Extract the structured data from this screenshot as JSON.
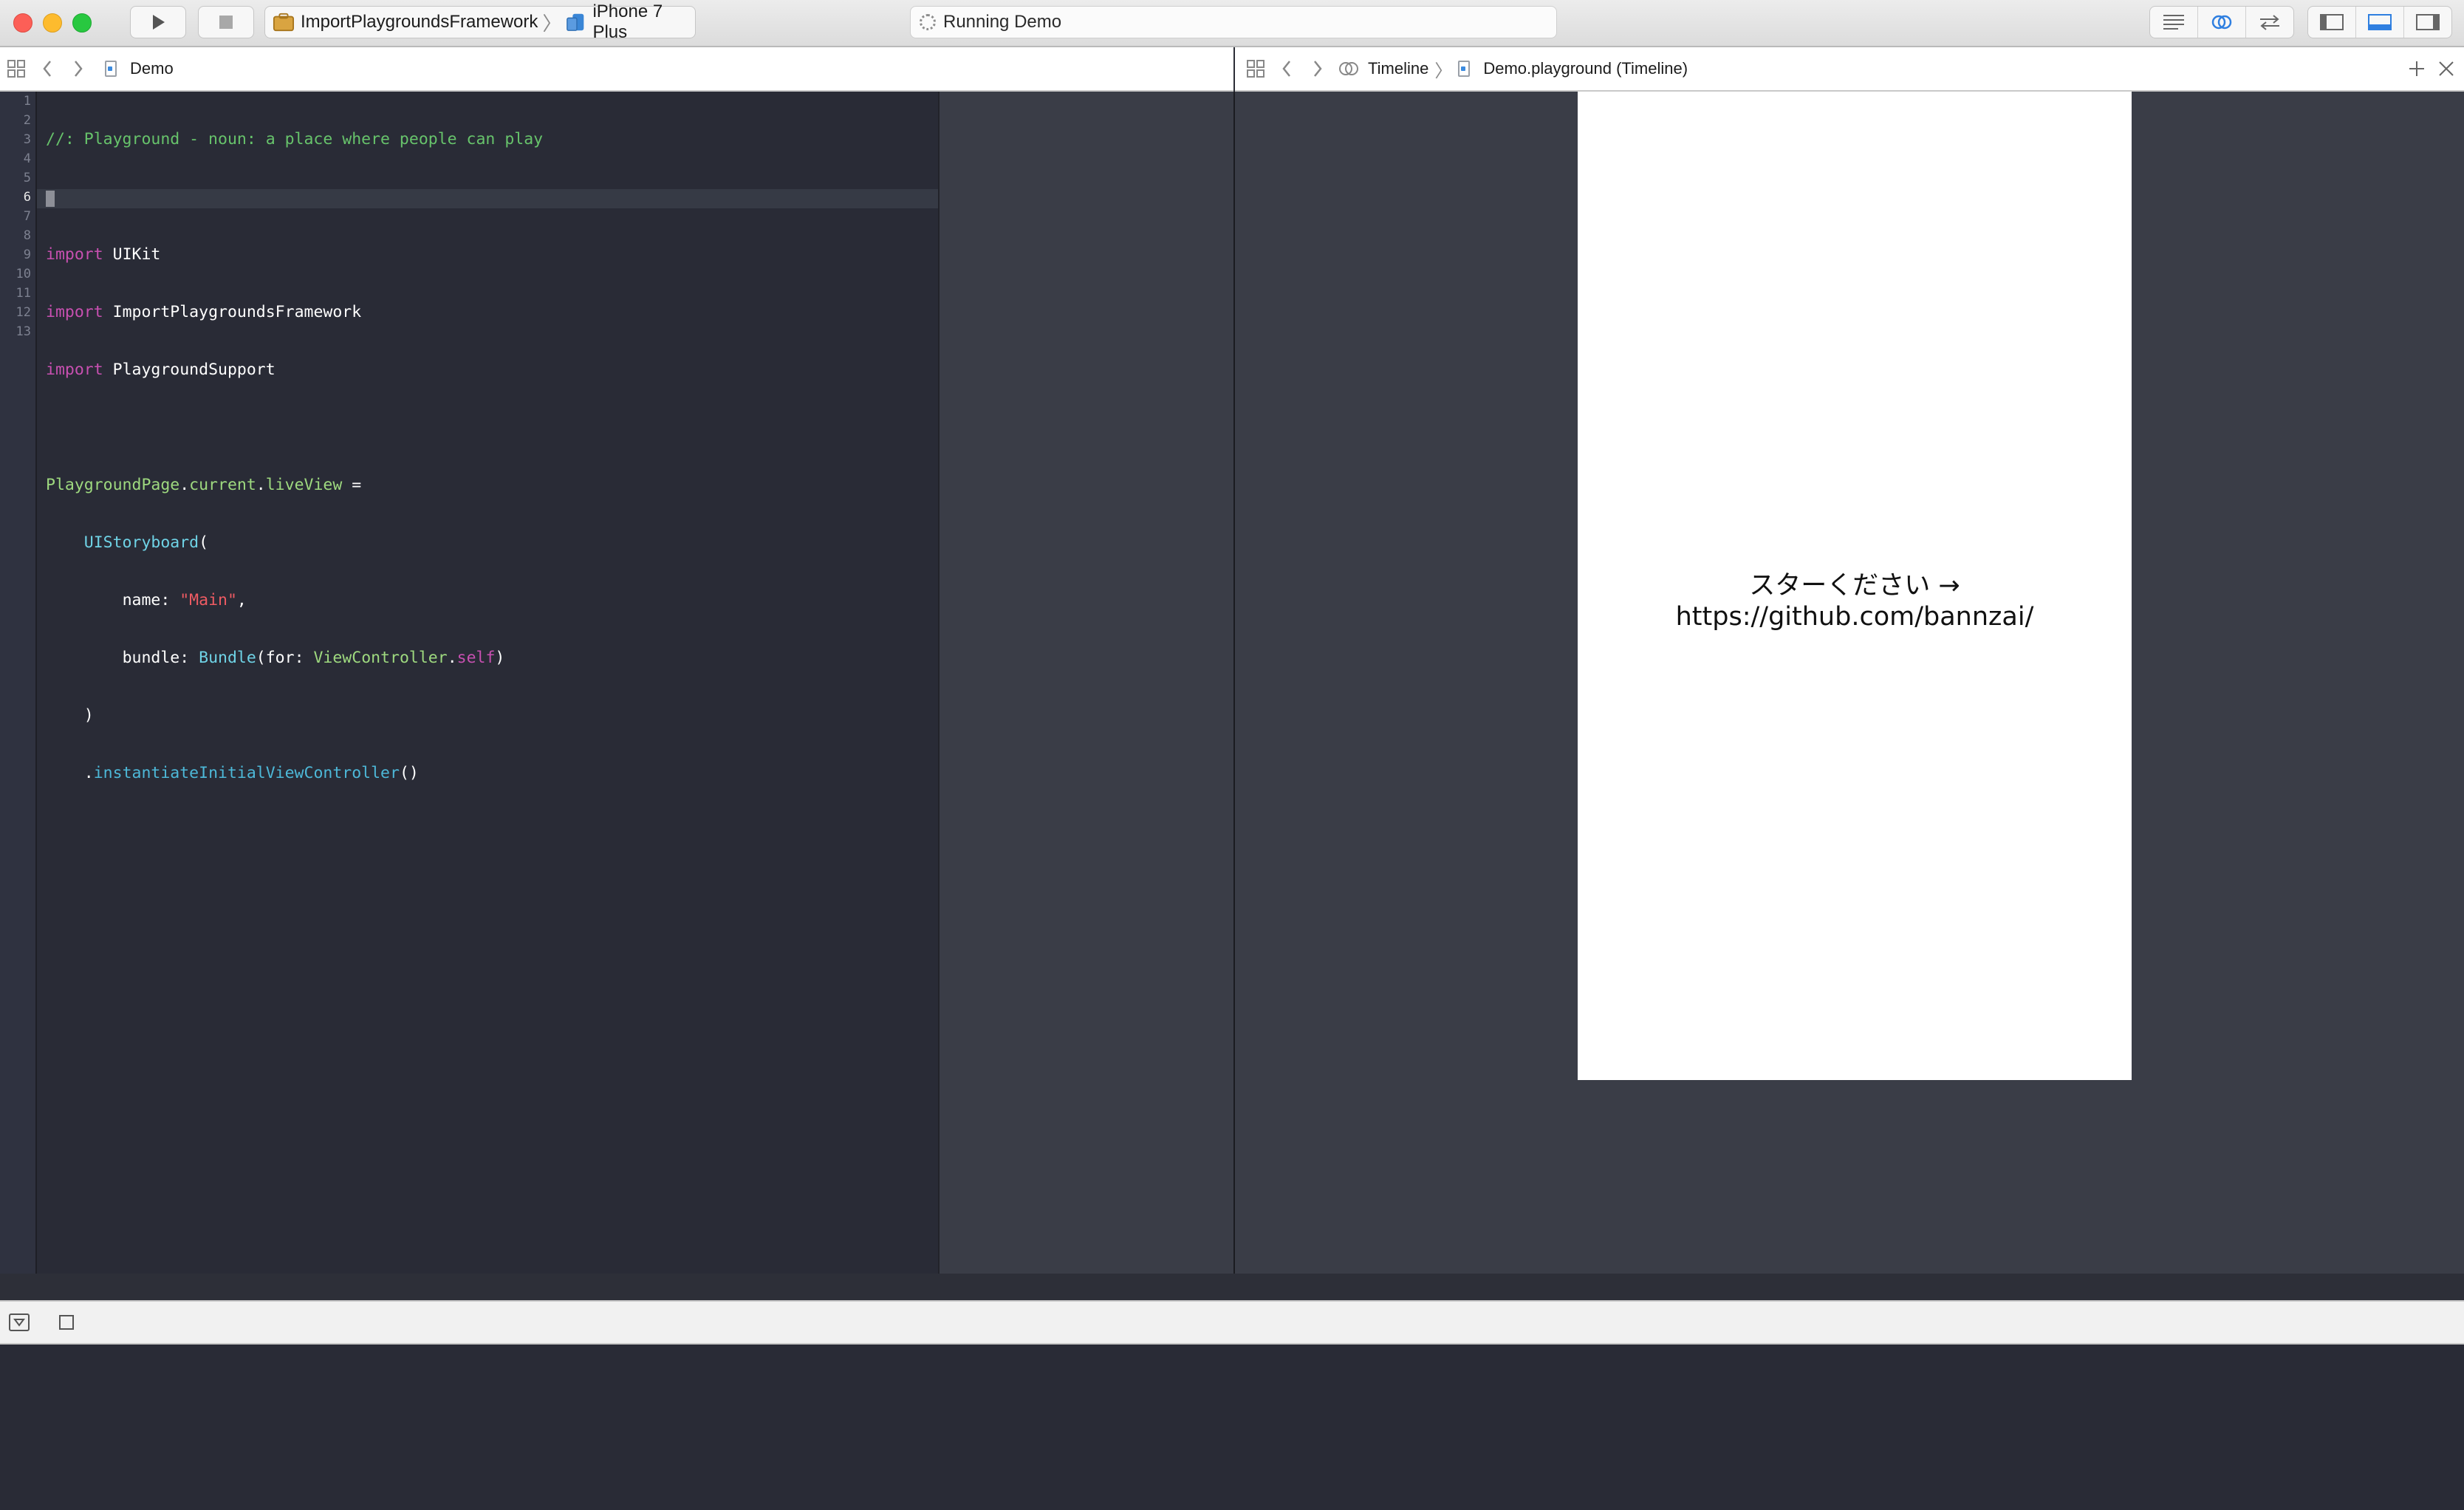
{
  "toolbar": {
    "scheme_target": "ImportPlaygroundsFramework",
    "scheme_device": "iPhone 7 Plus",
    "activity_status": "Running Demo",
    "run_icon": "play-icon",
    "stop_icon": "stop-icon"
  },
  "left_jumpbar": {
    "file_name": "Demo"
  },
  "right_jumpbar": {
    "mode": "Timeline",
    "file_name": "Demo.playground (Timeline)"
  },
  "editor": {
    "line_numbers": [
      "1",
      "2",
      "3",
      "4",
      "5",
      "6",
      "7",
      "8",
      "9",
      "10",
      "11",
      "12",
      "13"
    ],
    "active_line": "6",
    "lines": [
      "//: Playground - noun: a place where people can play",
      "",
      "import UIKit",
      "import ImportPlaygroundsFramework",
      "import PlaygroundSupport",
      "",
      "PlaygroundPage.current.liveView =",
      "    UIStoryboard(",
      "        name: \"Main\",",
      "        bundle: Bundle(for: ViewController.self)",
      "    )",
      "    .instantiateInitialViewController()",
      ""
    ],
    "tokens": {
      "comment": "//: Playground - noun: a place where people can play",
      "import_kw": "import",
      "uikit": "UIKit",
      "framework": "ImportPlaygroundsFramework",
      "support": "PlaygroundSupport",
      "playground_page": "PlaygroundPage",
      "dot1": ".",
      "current": "current",
      "dot2": ".",
      "live_view": "liveView",
      "assign": " =",
      "storyboard": "UIStoryboard",
      "paren_open": "(",
      "name_label": "name: ",
      "main_str": "\"Main\"",
      "comma": ",",
      "bundle_label": "bundle: ",
      "bundle_type": "Bundle",
      "for_label": "(for: ",
      "view_controller": "ViewController",
      "dot3": ".",
      "self_kw": "self",
      "paren_close": ")",
      "close_paren": ")",
      "dot4": ".",
      "instantiate": "instantiateInitialViewController",
      "call_parens": "()"
    }
  },
  "live_view": {
    "label": "スターください → https://github.com/bannzai/"
  },
  "colors": {
    "editor_bg": "#292b36",
    "keyword": "#c850b1",
    "comment": "#67c36b",
    "type": "#6fd3e6",
    "string": "#ef5b63"
  }
}
